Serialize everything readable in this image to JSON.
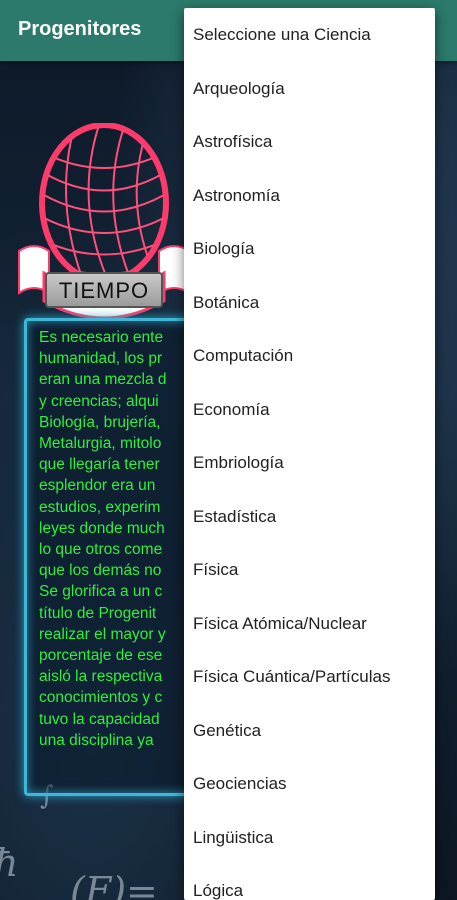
{
  "appbar": {
    "title": "Progenitores"
  },
  "tiempo_button": {
    "label": "TIEMPO"
  },
  "description_lines": [
    "Es necesario ente",
    "humanidad, los pr",
    "eran una mezcla d",
    "y creencias; alqui",
    "Biología, brujería,",
    "Metalurgia, mitolo",
    "que llegaría tener",
    "esplendor era un",
    "estudios, experim",
    "leyes donde much",
    "lo que otros come",
    "que los demás no",
    "Se glorifica a un c",
    "título de Progenit",
    "realizar el mayor y",
    "porcentaje de ese",
    "aisló la respectiva",
    "conocimientos y c",
    "tuvo la capacidad",
    "una disciplina ya"
  ],
  "menu": {
    "items": [
      "Seleccione una Ciencia",
      "Arqueología",
      "Astrofísica",
      "Astronomía",
      "Biología",
      "Botánica",
      "Computación",
      "Economía",
      "Embriología",
      "Estadística",
      "Física",
      "Física Atómica/Nuclear",
      "Física Cuántica/Partículas",
      "Genética",
      "Geociencias",
      "Lingüistica",
      "Lógica"
    ]
  },
  "colors": {
    "appbar": "#2b7a6b",
    "text_green": "#2ef03a",
    "frame_blue": "#3fb8d8",
    "logo_red": "#ff3b6b"
  },
  "icons": {
    "logo": "globe-ribbon-logo"
  }
}
